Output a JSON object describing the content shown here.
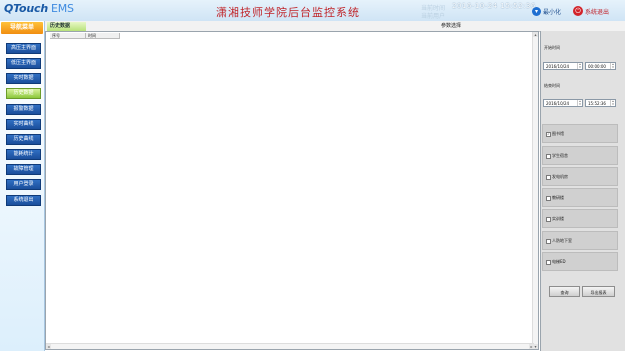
{
  "header": {
    "logo": "QTouch",
    "logo_suffix": "EMS",
    "title": "潇湘技师学院后台监控系统",
    "faint_line1": "当前时间",
    "faint_line2": "当前用户",
    "clock": "2016-10-24 15:52:36",
    "minimize_label": "最小化",
    "exit_label": "系统退出"
  },
  "sidebar": {
    "header": "导航菜单",
    "items": [
      {
        "label": "高压主界面"
      },
      {
        "label": "低压主界面"
      },
      {
        "label": "实时数据"
      },
      {
        "label": "历史数据"
      },
      {
        "label": "报警数据"
      },
      {
        "label": "实时曲线"
      },
      {
        "label": "历史曲线"
      },
      {
        "label": "能耗统计"
      },
      {
        "label": "故障管理"
      },
      {
        "label": "用户登录"
      },
      {
        "label": "系统退出"
      }
    ],
    "active_index": 3
  },
  "tabs": {
    "history": "历史数据",
    "params": "参数选择"
  },
  "table": {
    "columns": [
      "序号",
      "时间"
    ]
  },
  "params": {
    "start_label": "开始时间",
    "start_date": "2016/10/24",
    "start_time": "00:00:00",
    "end_label": "结束时间",
    "end_date": "2016/10/24",
    "end_time": "15:52:36",
    "options": [
      {
        "label": "图书馆",
        "checked": true
      },
      {
        "label": "学生宿舍",
        "checked": false
      },
      {
        "label": "发电机房",
        "checked": false
      },
      {
        "label": "教研楼",
        "checked": false
      },
      {
        "label": "实训楼",
        "checked": false
      },
      {
        "label": "人防地下室",
        "checked": false
      },
      {
        "label": "电梯ED",
        "checked": false
      }
    ],
    "query_button": "查询",
    "export_button": "导出报表"
  }
}
